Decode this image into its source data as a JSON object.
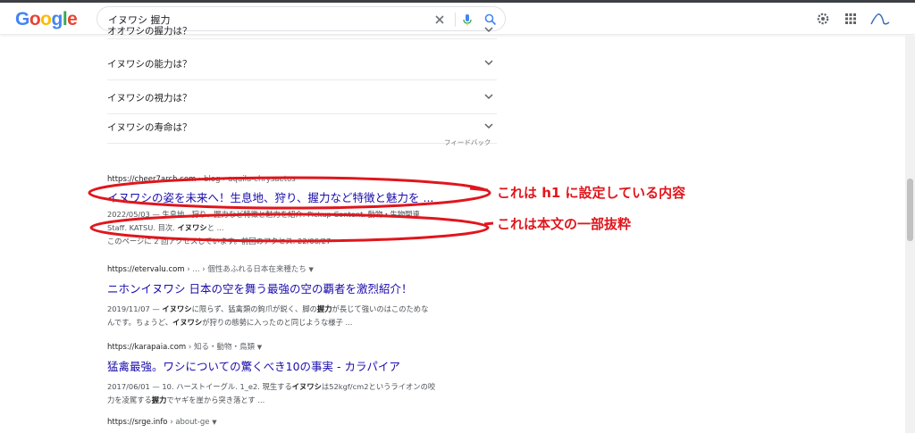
{
  "header": {
    "logo_letters": [
      {
        "ch": "G",
        "color": "#4285f4"
      },
      {
        "ch": "o",
        "color": "#ea4335"
      },
      {
        "ch": "o",
        "color": "#fbbc05"
      },
      {
        "ch": "g",
        "color": "#4285f4"
      },
      {
        "ch": "l",
        "color": "#34a853"
      },
      {
        "ch": "e",
        "color": "#ea4335"
      }
    ],
    "search_value": "イヌワシ 握力",
    "icons": [
      "clear-icon",
      "mic-icon",
      "search-icon",
      "settings-gear-icon",
      "apps-grid-icon",
      "account-avatar-icon"
    ]
  },
  "paa": {
    "partial_question": "オオワシの握力は？",
    "questions": [
      "イヌワシの能力は？",
      "イヌワシの視力は？",
      "イヌワシの寿命は？"
    ],
    "feedback_label": "フィードバック"
  },
  "results": [
    {
      "cite_domain": "https://cheer7arch.com",
      "cite_path": " › blog › aquila-chrysaetos",
      "title": "イヌワシの姿を未来へ！生息地、狩り、握力など特徴と魅力を ...",
      "snippet_1_date": "2022/05/03 — ",
      "snippet_1": "生息地、狩り、握力など特徴と魅力を紹介. Pickup Content. 動物・生物関連",
      "snippet_2_pre": "Staff. KATSU. 目次. ",
      "snippet_2_bold": "イヌワシ",
      "snippet_2_post": "と ...",
      "snippet_3": "このページに 2 回アクセスしています。前回のアクセス: 22/06/27"
    },
    {
      "cite_domain": "https://etervalu.com",
      "cite_path": " › ... › 個性あふれる日本在来種たち",
      "title": "ニホンイヌワシ 日本の空を舞う最強の空の覇者を激烈紹介！",
      "snippet_1_date": "2019/11/07 — ",
      "snippet_1_bold_a": "イヌワシ",
      "snippet_1_mid": "に限らず、猛禽類の鉤爪が鋭く、脚の",
      "snippet_1_bold_b": "握力",
      "snippet_1_post": "が長じて強いのはこのためな",
      "snippet_2_pre": "んです。ちょうど、",
      "snippet_2_bold": "イヌワシ",
      "snippet_2_post": "が狩りの態勢に入ったのと同じような様子 ..."
    },
    {
      "cite_domain": "https://karapaia.com",
      "cite_path": " › 知る・動物・鳥類",
      "title": "猛禽最強。ワシについての驚くべき10の事実 - カラパイア",
      "snippet_1_date": "2017/06/01 — ",
      "snippet_1_pre": "10. ハーストイーグル. 1_e2. 現生する",
      "snippet_1_bold": "イヌワシ",
      "snippet_1_post": "は52kgf/cm2というライオンの咬",
      "snippet_2_pre": "力を凌駕する",
      "snippet_2_bold": "握力",
      "snippet_2_post": "でヤギを崖から突き落とす ..."
    },
    {
      "cite_domain": "https://srge.info",
      "cite_path": " › about-ge"
    }
  ],
  "annotations": {
    "h1_note": "これは h1 に設定している内容",
    "body_note": "これは本文の一部抜粋",
    "ellipse_color": "#e0161c"
  }
}
